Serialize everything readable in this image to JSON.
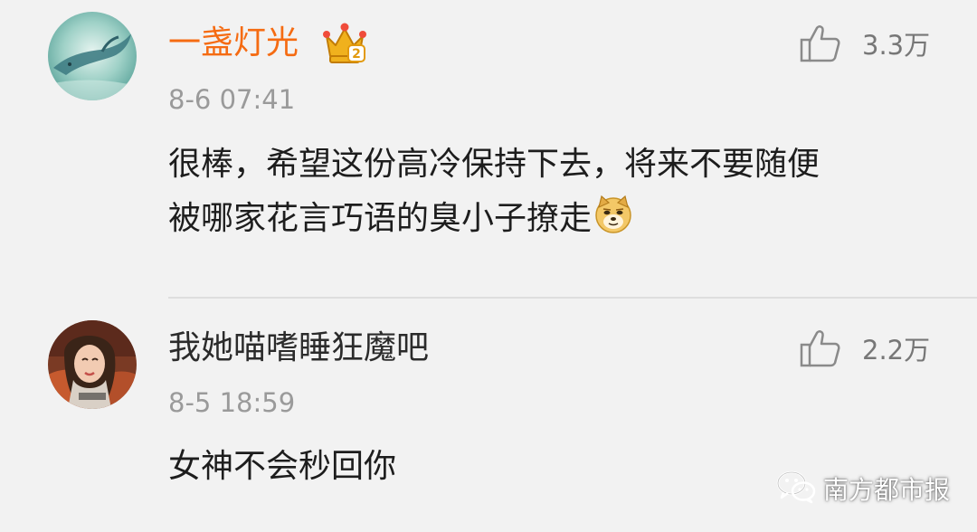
{
  "comments": [
    {
      "username": "一盏灯光",
      "vip_badge_level": "2",
      "timestamp": "8-6 07:41",
      "like_count": "3.3万",
      "text_line_1": "很棒，希望这份高冷保持下去，将来不要随便",
      "text_line_2": "被哪家花言巧语的臭小子撩走",
      "emoji": "doge-icon"
    },
    {
      "username": "我她喵嗜睡狂魔吧",
      "timestamp": "8-5 18:59",
      "like_count": "2.2万",
      "text_line_1": "女神不会秒回你"
    }
  ],
  "watermark": {
    "label": "南方都市报",
    "icon": "wechat-icon"
  },
  "colors": {
    "background": "#f2f2f2",
    "vip_username": "#f56b12",
    "username": "#2b2b2b",
    "timestamp": "#9a9a9a",
    "body_text": "#1d1d1d"
  }
}
